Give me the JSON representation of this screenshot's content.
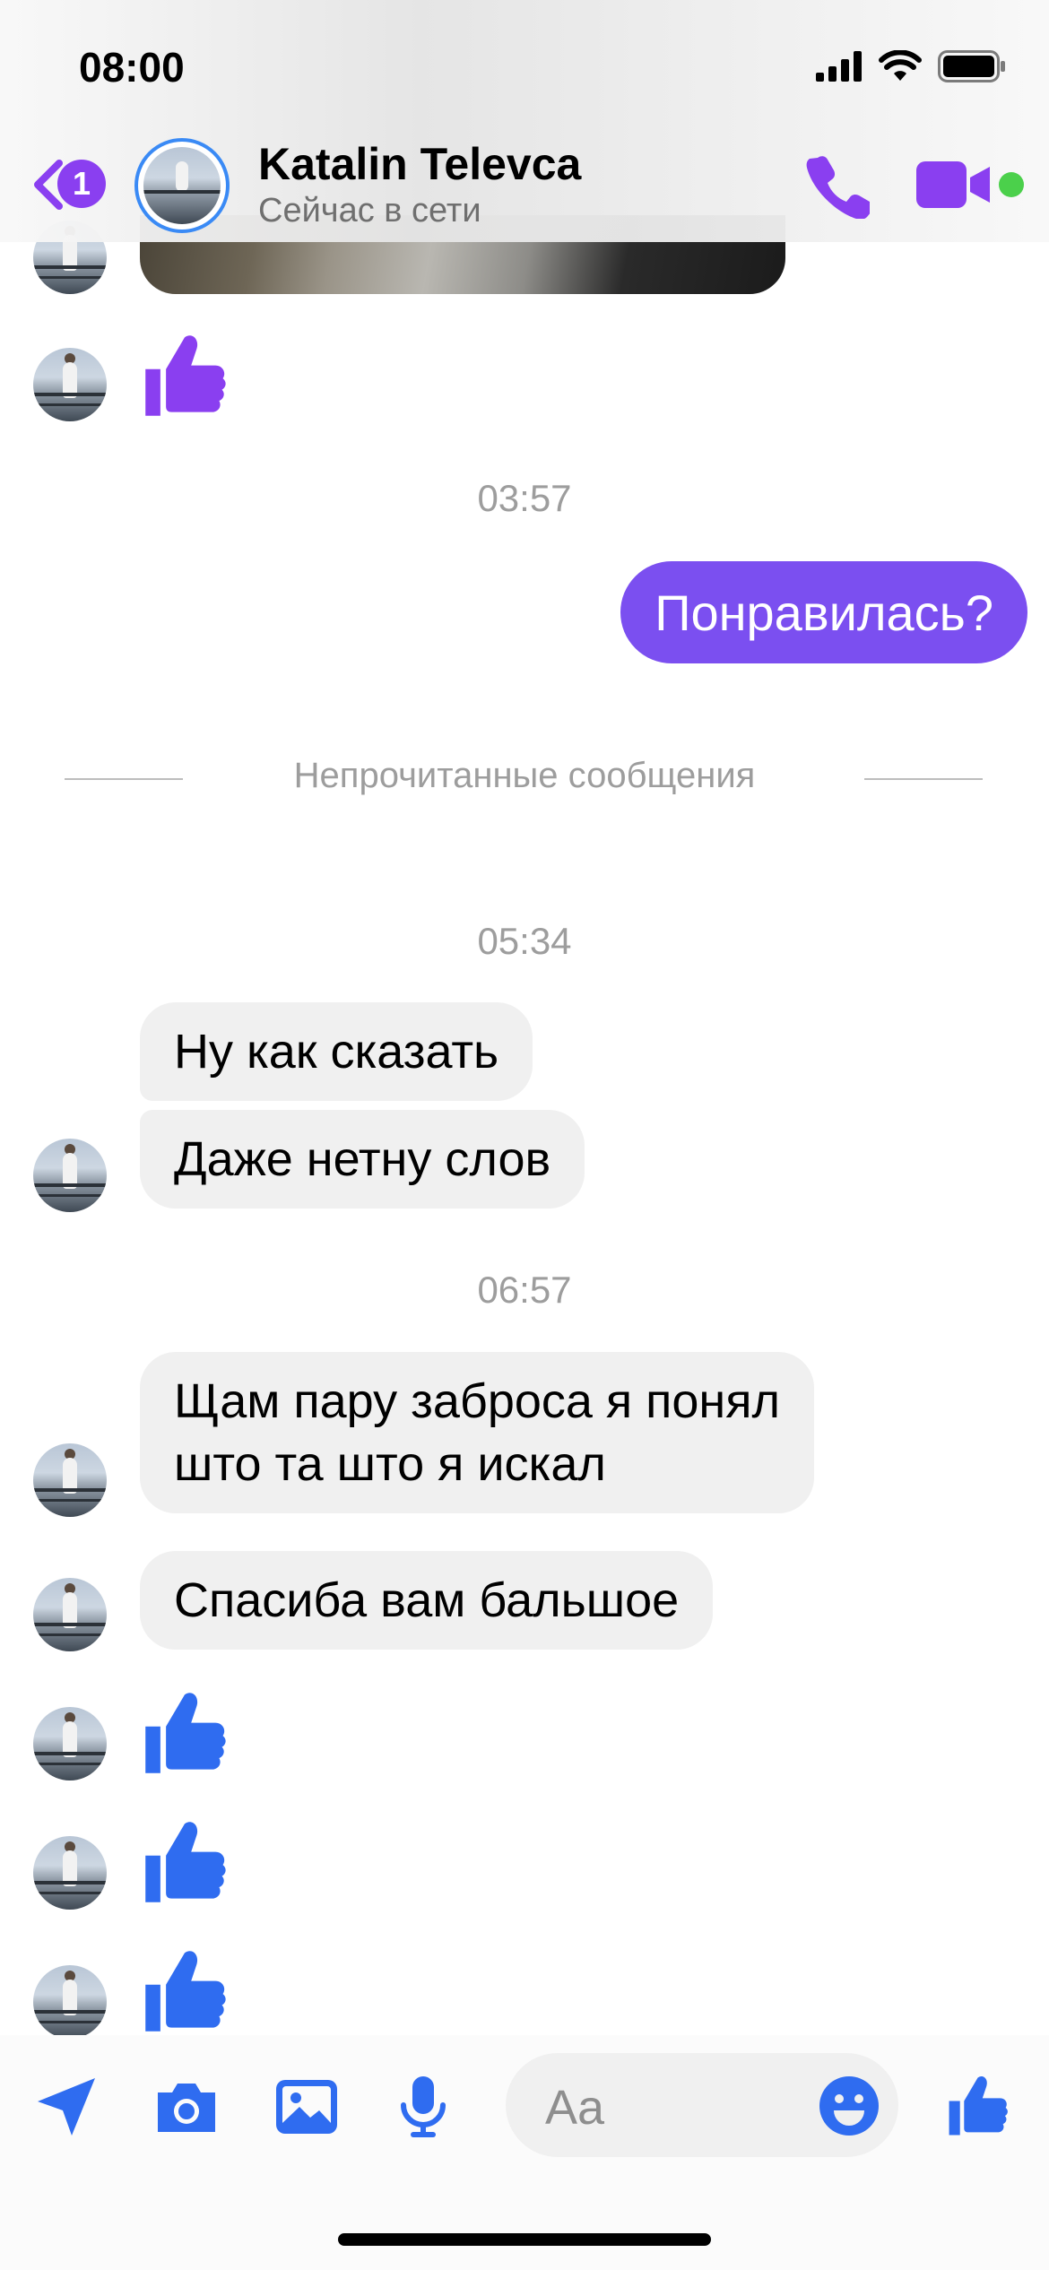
{
  "status_bar": {
    "time": "08:00"
  },
  "header": {
    "back_badge": "1",
    "contact_name": "Katalin Televca",
    "contact_status": "Сейчас в сети",
    "icons": [
      "back-chevron-icon",
      "phone-icon",
      "video-icon"
    ],
    "accent_color": "#8a3ff0",
    "online_color": "#4bd04b"
  },
  "messages": {
    "time_1": "03:57",
    "outgoing_1": "Понравилась?",
    "unread_divider": "Непрочитанные сообщения",
    "time_2": "05:34",
    "incoming_1": "Ну как сказать",
    "incoming_2": "Даже нетну слов",
    "time_3": "06:57",
    "incoming_3_line1": "Щам пару заброса я понял",
    "incoming_3_line2": "што та што я искал",
    "incoming_4": "Спасиба вам бальшое",
    "like_colors": {
      "purple": "#8a3ff0",
      "blue": "#2f6cf0"
    },
    "outgoing_bubble_color": "#7b4ff0"
  },
  "composer": {
    "placeholder": "Aa",
    "icons": [
      "location-arrow-icon",
      "camera-icon",
      "gallery-icon",
      "microphone-icon",
      "emoji-icon",
      "thumbs-up-icon"
    ],
    "icon_color": "#2f6cf0"
  }
}
